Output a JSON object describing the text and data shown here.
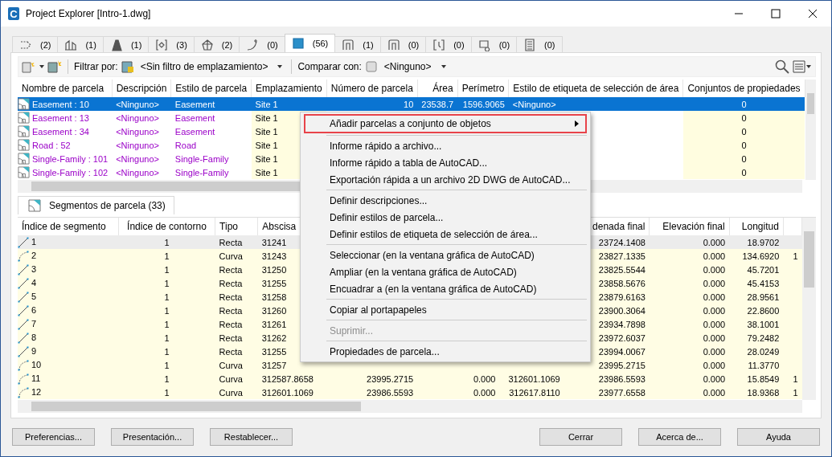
{
  "window": {
    "app_icon_letter": "C",
    "title": "Project Explorer [Intro-1.dwg]"
  },
  "object_tabs": [
    {
      "count": "(2)",
      "selected": false
    },
    {
      "count": "(1)",
      "selected": false
    },
    {
      "count": "(1)",
      "selected": false
    },
    {
      "count": "(3)",
      "selected": false
    },
    {
      "count": "(2)",
      "selected": false
    },
    {
      "count": "(0)",
      "selected": false
    },
    {
      "count": "(56)",
      "selected": true
    },
    {
      "count": "(1)",
      "selected": false
    },
    {
      "count": "(0)",
      "selected": false
    },
    {
      "count": "(0)",
      "selected": false
    },
    {
      "count": "(0)",
      "selected": false
    },
    {
      "count": "(0)",
      "selected": false
    }
  ],
  "toolbar": {
    "filter_label": "Filtrar por:",
    "filter_value": "<Sin filtro de emplazamiento>",
    "compare_label": "Comparar con:",
    "compare_value": "<Ninguno>"
  },
  "parcels_table": {
    "columns": [
      {
        "label": "Nombre de parcela",
        "editable": false
      },
      {
        "label": "Descripción",
        "editable": false
      },
      {
        "label": "Estilo de parcela",
        "editable": false
      },
      {
        "label": "Emplazamiento",
        "editable": true
      },
      {
        "label": "Número de parcela",
        "editable": false
      },
      {
        "label": "Área",
        "editable": false
      },
      {
        "label": "Perímetro",
        "editable": false
      },
      {
        "label": "Estilo de etiqueta de selección de área",
        "editable": false
      },
      {
        "label": "Conjuntos de propiedades",
        "editable": true
      }
    ],
    "rows": [
      {
        "selected": true,
        "cells": [
          "Easement : 10",
          "<Ninguno>",
          "Easement",
          "Site 1",
          "10",
          "23538.7",
          "1596.9065",
          "<Ninguno>",
          "0"
        ]
      },
      {
        "selected": false,
        "cells": [
          "Easement : 13",
          "<Ninguno>",
          "Easement",
          "Site 1",
          null,
          null,
          null,
          null,
          "0"
        ]
      },
      {
        "selected": false,
        "cells": [
          "Easement : 34",
          "<Ninguno>",
          "Easement",
          "Site 1",
          null,
          null,
          null,
          null,
          "0"
        ]
      },
      {
        "selected": false,
        "cells": [
          "Road : 52",
          "<Ninguno>",
          "Road",
          "Site 1",
          null,
          null,
          null,
          null,
          "0"
        ]
      },
      {
        "selected": false,
        "cells": [
          "Single-Family : 101",
          "<Ninguno>",
          "Single-Family",
          "Site 1",
          null,
          null,
          null,
          null,
          "0"
        ]
      },
      {
        "selected": false,
        "cells": [
          "Single-Family : 102",
          "<Ninguno>",
          "Single-Family",
          "Site 1",
          null,
          null,
          null,
          null,
          "0"
        ]
      }
    ]
  },
  "segments_tab": {
    "label": "Segmentos de parcela (33)",
    "selected": true
  },
  "segments_table": {
    "columns": [
      {
        "label": "Índice de segmento"
      },
      {
        "label": "Índice de contorno"
      },
      {
        "label": "Tipo"
      },
      {
        "label": "Abscisa"
      },
      {},
      {},
      {},
      {
        "label": "denada final"
      },
      {
        "label": "Elevación final"
      },
      {
        "label": "Longitud"
      },
      {}
    ],
    "rows": [
      {
        "kind": "line",
        "selected": true,
        "cells": [
          "1",
          "1",
          "Recta",
          "31241",
          null,
          null,
          null,
          "23724.1408",
          "0.000",
          "18.9702",
          null
        ]
      },
      {
        "kind": "curve",
        "selected": false,
        "cells": [
          "2",
          "1",
          "Curva",
          "31243",
          null,
          null,
          null,
          "23827.1335",
          "0.000",
          "134.6920",
          "1"
        ]
      },
      {
        "kind": "line",
        "selected": false,
        "cells": [
          "3",
          "1",
          "Recta",
          "31250",
          null,
          null,
          null,
          "23825.5544",
          "0.000",
          "45.7201",
          null
        ]
      },
      {
        "kind": "line",
        "selected": false,
        "cells": [
          "4",
          "1",
          "Recta",
          "31255",
          null,
          null,
          null,
          "23858.5676",
          "0.000",
          "45.4153",
          null
        ]
      },
      {
        "kind": "line",
        "selected": false,
        "cells": [
          "5",
          "1",
          "Recta",
          "31258",
          null,
          null,
          null,
          "23879.6163",
          "0.000",
          "28.9561",
          null
        ]
      },
      {
        "kind": "line",
        "selected": false,
        "cells": [
          "6",
          "1",
          "Recta",
          "31260",
          null,
          null,
          null,
          "23900.3064",
          "0.000",
          "22.8600",
          null
        ]
      },
      {
        "kind": "line",
        "selected": false,
        "cells": [
          "7",
          "1",
          "Recta",
          "31261",
          null,
          null,
          null,
          "23934.7898",
          "0.000",
          "38.1001",
          null
        ]
      },
      {
        "kind": "line",
        "selected": false,
        "cells": [
          "8",
          "1",
          "Recta",
          "31262",
          null,
          null,
          null,
          "23972.6037",
          "0.000",
          "79.2482",
          null
        ]
      },
      {
        "kind": "line",
        "selected": false,
        "cells": [
          "9",
          "1",
          "Recta",
          "31255",
          null,
          null,
          null,
          "23994.0067",
          "0.000",
          "28.0249",
          null
        ]
      },
      {
        "kind": "curve",
        "selected": false,
        "cells": [
          "10",
          "1",
          "Curva",
          "31257",
          null,
          null,
          null,
          "23995.2715",
          "0.000",
          "11.3770",
          null
        ]
      },
      {
        "kind": "curve",
        "selected": false,
        "cells": [
          "11",
          "1",
          "Curva",
          "312587.8658",
          "23995.2715",
          "0.000",
          "312601.1069",
          "23986.5593",
          "0.000",
          "15.8549",
          "1"
        ]
      },
      {
        "kind": "curve",
        "selected": false,
        "cells": [
          "12",
          "1",
          "Curva",
          "312601.1069",
          "23986.5593",
          "0.000",
          "312617.8110",
          "23977.6558",
          "0.000",
          "18.9368",
          "1"
        ]
      }
    ]
  },
  "context_menu": {
    "groups": [
      [
        {
          "label": "Añadir parcelas a conjunto de objetos",
          "submenu": true,
          "disabled": false,
          "highlighted": true
        }
      ],
      [
        {
          "label": "Informe rápido a archivo...",
          "submenu": false,
          "disabled": false,
          "highlighted": false
        },
        {
          "label": "Informe rápido a tabla de AutoCAD...",
          "submenu": false,
          "disabled": false,
          "highlighted": false
        },
        {
          "label": "Exportación rápida a un archivo 2D DWG de AutoCAD...",
          "submenu": false,
          "disabled": false,
          "highlighted": false
        }
      ],
      [
        {
          "label": "Definir descripciones...",
          "submenu": false,
          "disabled": false,
          "highlighted": false
        },
        {
          "label": "Definir estilos de parcela...",
          "submenu": false,
          "disabled": false,
          "highlighted": false
        },
        {
          "label": "Definir estilos de etiqueta de selección de área...",
          "submenu": false,
          "disabled": false,
          "highlighted": false
        }
      ],
      [
        {
          "label": "Seleccionar (en la ventana gráfica de AutoCAD)",
          "submenu": false,
          "disabled": false,
          "highlighted": false
        },
        {
          "label": "Ampliar (en la ventana gráfica de AutoCAD)",
          "submenu": false,
          "disabled": false,
          "highlighted": false
        },
        {
          "label": "Encuadrar a (en la ventana gráfica de AutoCAD)",
          "submenu": false,
          "disabled": false,
          "highlighted": false
        }
      ],
      [
        {
          "label": "Copiar al portapapeles",
          "submenu": false,
          "disabled": false,
          "highlighted": false
        }
      ],
      [
        {
          "label": "Suprimir...",
          "submenu": false,
          "disabled": true,
          "highlighted": false
        }
      ],
      [
        {
          "label": "Propiedades de parcela...",
          "submenu": false,
          "disabled": false,
          "highlighted": false
        }
      ]
    ]
  },
  "left_buttons": [
    "Preferencias...",
    "Presentación...",
    "Restablecer..."
  ],
  "right_buttons": [
    "Cerrar",
    "Acerca de...",
    "Ayuda"
  ]
}
